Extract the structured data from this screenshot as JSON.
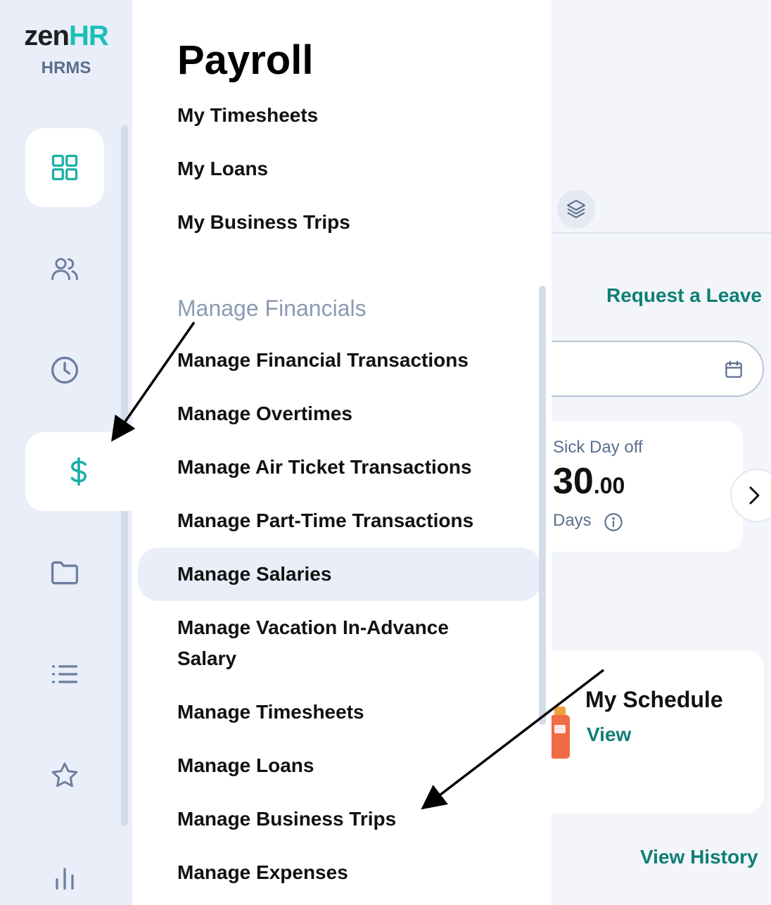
{
  "logo": {
    "word_left": "zen",
    "word_right": "HR",
    "subtitle": "HRMS"
  },
  "rail": {
    "items": [
      {
        "icon": "dashboard-grid-icon"
      },
      {
        "icon": "users-icon"
      },
      {
        "icon": "clock-icon"
      },
      {
        "icon": "dollar-icon",
        "active": true
      },
      {
        "icon": "folder-icon"
      },
      {
        "icon": "list-icon"
      },
      {
        "icon": "star-icon"
      },
      {
        "icon": "bar-chart-icon"
      }
    ]
  },
  "flyout": {
    "title": "Payroll",
    "items_top": [
      "My Timesheets",
      "My Loans",
      "My Business Trips"
    ],
    "section_label": "Manage Financials",
    "items_manage": [
      "Manage Financial Transactions",
      "Manage Overtimes",
      "Manage Air Ticket Transactions",
      "Manage Part-Time Transactions",
      "Manage Salaries",
      "Manage Vacation In-Advance",
      "Salary",
      "Manage Timesheets",
      "Manage Loans",
      "Manage Business Trips",
      "Manage Expenses"
    ],
    "highlighted": "Manage Salaries"
  },
  "dashboard": {
    "request_leave": "Request a Leave",
    "balance": {
      "label": "Sick Day off",
      "value_int": "30",
      "value_dec": ".00",
      "unit": "Days"
    },
    "schedule": {
      "title": "My Schedule",
      "link": "View"
    },
    "view_history": "View History"
  },
  "colors": {
    "teal": "#0d7f74",
    "brand_teal": "#19c0b6",
    "muted": "#8a9bb4",
    "rail_bg": "#e9eef9"
  }
}
